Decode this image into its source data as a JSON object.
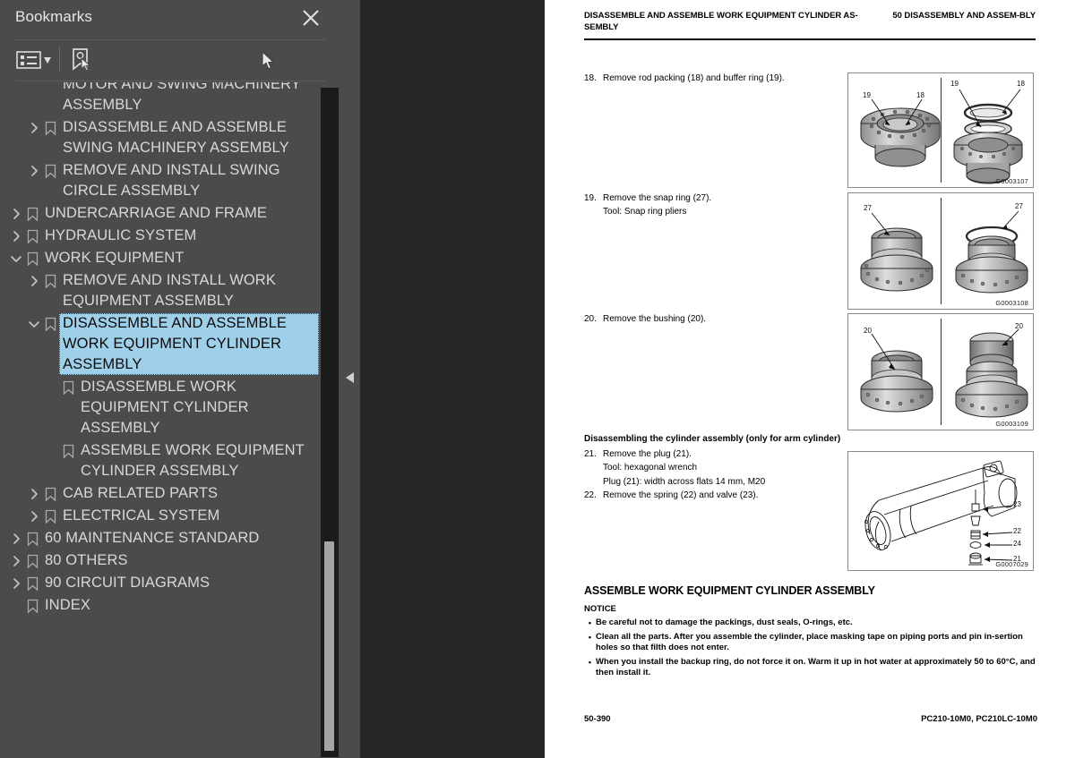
{
  "panel": {
    "title": "Bookmarks",
    "close_icon": "close-icon",
    "toolbar": {
      "options_icon": "list-options-icon",
      "bookmark_pointer_icon": "bookmark-select-icon"
    },
    "items": [
      {
        "level": 1,
        "arrow": "chevron-right",
        "label": "REMOVE AND INSTALL SWIVEL MOTOR AND SWING MACHINERY ASSEMBLY",
        "selected": false
      },
      {
        "level": 1,
        "arrow": "chevron-right",
        "label": "DISASSEMBLE AND ASSEMBLE SWING MACHINERY ASSEMBLY",
        "selected": false
      },
      {
        "level": 1,
        "arrow": "chevron-right",
        "label": "REMOVE AND INSTALL SWING CIRCLE ASSEMBLY",
        "selected": false
      },
      {
        "level": 0,
        "arrow": "chevron-right",
        "label": "UNDERCARRIAGE AND FRAME",
        "selected": false
      },
      {
        "level": 0,
        "arrow": "chevron-right",
        "label": "HYDRAULIC SYSTEM",
        "selected": false
      },
      {
        "level": 0,
        "arrow": "chevron-down",
        "label": "WORK EQUIPMENT",
        "selected": false
      },
      {
        "level": 1,
        "arrow": "chevron-right",
        "label": "REMOVE AND INSTALL WORK EQUIPMENT ASSEMBLY",
        "selected": false
      },
      {
        "level": 1,
        "arrow": "chevron-down",
        "label": "DISASSEMBLE AND ASSEMBLE WORK EQUIPMENT CYLINDER ASSEMBLY",
        "selected": true
      },
      {
        "level": 2,
        "arrow": "none",
        "label": "DISASSEMBLE WORK EQUIPMENT CYLINDER ASSEMBLY",
        "selected": false
      },
      {
        "level": 2,
        "arrow": "none",
        "label": "ASSEMBLE WORK EQUIPMENT CYLINDER ASSEMBLY",
        "selected": false
      },
      {
        "level": 1,
        "arrow": "chevron-right",
        "label": "CAB RELATED PARTS",
        "selected": false
      },
      {
        "level": 1,
        "arrow": "chevron-right",
        "label": "ELECTRICAL SYSTEM",
        "selected": false
      },
      {
        "level": 0,
        "arrow": "chevron-right",
        "label": "60 MAINTENANCE STANDARD",
        "selected": false
      },
      {
        "level": 0,
        "arrow": "chevron-right",
        "label": "80 OTHERS",
        "selected": false
      },
      {
        "level": 0,
        "arrow": "chevron-right",
        "label": "90 CIRCUIT DIAGRAMS",
        "selected": false
      },
      {
        "level": 0,
        "arrow": "none",
        "label": "INDEX",
        "selected": false
      }
    ],
    "selection_color": "#9fd0ea",
    "background_color": "#4b4b4b"
  },
  "splitter": {
    "collapse_icon": "collapse-left-arrow-icon"
  },
  "page": {
    "header_left": "DISASSEMBLE AND ASSEMBLE WORK EQUIPMENT CYLINDER AS-SEMBLY",
    "header_right": "50 DISASSEMBLY AND ASSEM-BLY",
    "steps": [
      {
        "num": "18.",
        "text": "Remove rod packing (18) and buffer ring (19).",
        "sub": []
      },
      {
        "num": "19.",
        "text": "Remove the snap ring (27).",
        "sub": [
          "Tool: Snap ring pliers"
        ]
      },
      {
        "num": "20.",
        "text": "Remove the bushing (20).",
        "sub": []
      }
    ],
    "section_heading": "Disassembling the cylinder assembly (only for arm cylinder)",
    "steps2": [
      {
        "num": "21.",
        "text": "Remove the plug (21).",
        "sub": [
          "Tool: hexagonal wrench",
          "Plug (21): width across flats 14 mm, M20"
        ]
      },
      {
        "num": "22.",
        "text": "Remove the spring (22) and valve (23).",
        "sub": []
      }
    ],
    "figures": [
      {
        "id": "G0003107",
        "callouts": [
          "19",
          "18",
          "19",
          "18"
        ]
      },
      {
        "id": "G0003108",
        "callouts": [
          "27",
          "27"
        ]
      },
      {
        "id": "G0003109",
        "callouts": [
          "20",
          "20"
        ]
      },
      {
        "id": "G0007029",
        "callouts": [
          "23",
          "22",
          "24",
          "21"
        ]
      }
    ],
    "assemble_heading": "ASSEMBLE WORK EQUIPMENT CYLINDER ASSEMBLY",
    "notice_label": "NOTICE",
    "notice_items": [
      "Be careful not to damage the packings, dust seals, O-rings, etc.",
      "Clean all the parts. After you assemble the cylinder, place masking tape on piping ports and pin in-sertion holes so that filth does not enter.",
      "When you install the backup ring, do not force it on. Warm it up in hot water at approximately 50 to 60°C, and then install it."
    ],
    "footer_left": "50-390",
    "footer_right": "PC210-10M0, PC210LC-10M0"
  }
}
